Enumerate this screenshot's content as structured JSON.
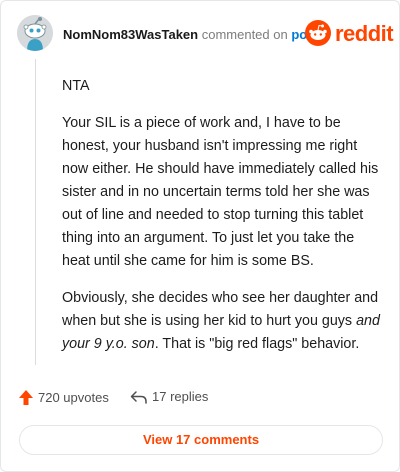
{
  "comment": {
    "username": "NomNom83WasTaken",
    "action_text": "commented on",
    "post_link": "post",
    "paragraphs": {
      "p1": "NTA",
      "p2": "Your SIL is a piece of work and, I have to be honest, your husband isn't impressing me right now either. He should have immediately called his sister and in no uncertain terms told her she was out of line and needed to stop turning this tablet thing into an argument. To just let you take the heat until she came for him is some BS.",
      "p3_start": "Obviously, she decides who see her daughter and when but she is using her kid to hurt you guys ",
      "p3_em": "and your 9 y.o. son",
      "p3_end": ". That is \"big red flags\" behavior."
    }
  },
  "brand": {
    "wordmark": "reddit",
    "icon": "reddit-snoo-icon",
    "color": "#ff4500"
  },
  "actions": {
    "upvotes": "720 upvotes",
    "replies": "17 replies",
    "upvote_icon": "upvote-arrow-icon",
    "reply_icon": "reply-arrow-icon"
  },
  "view_button": {
    "label": "View 17 comments"
  }
}
